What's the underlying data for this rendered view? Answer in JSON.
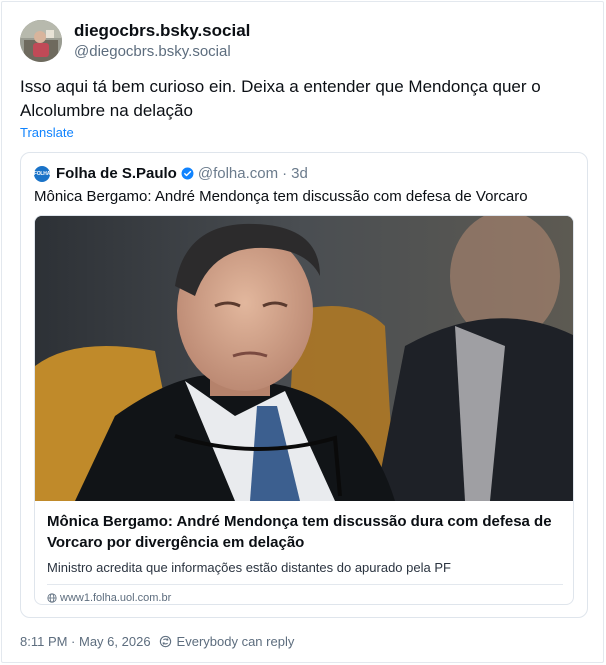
{
  "post": {
    "author": {
      "display_name": "diegocbrs.bsky.social",
      "handle": "@diegocbrs.bsky.social"
    },
    "text": "Isso aqui tá bem curioso ein. Deixa a entender que Mendonça quer o Alcolumbre na delação",
    "translate_label": "Translate",
    "timestamp": "8:11 PM · May 6, 2026",
    "reply_setting": "Everybody can reply"
  },
  "quote": {
    "name": "Folha de S.Paulo",
    "logo_text": "FOLHA",
    "handle": "@folha.com",
    "separator": "·",
    "time": "3d",
    "text": "Mônica Bergamo: André Mendonça tem discussão com defesa de Vorcaro",
    "embed": {
      "title": "Mônica Bergamo: André Mendonça tem discussão dura com defesa de Vorcaro por divergência em delação",
      "description": "Ministro acredita que informações estão distantes do apurado pela PF",
      "domain": "www1.folha.uol.com.br"
    }
  },
  "icons": {
    "verified": "verified-badge-icon",
    "globe": "globe-icon",
    "reply": "reply-settings-icon"
  },
  "colors": {
    "link": "#1083fe",
    "muted": "#5d6d7e",
    "verified": "#1083fe"
  }
}
